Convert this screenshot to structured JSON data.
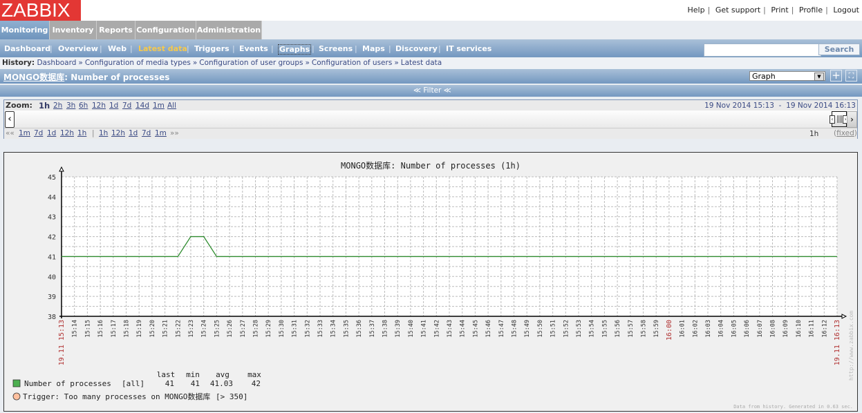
{
  "logo": "ZABBIX",
  "top_links": [
    "Help",
    "Get support",
    "Print",
    "Profile",
    "Logout"
  ],
  "main_menu": [
    {
      "label": "Monitoring",
      "active": true
    },
    {
      "label": "Inventory",
      "active": false
    },
    {
      "label": "Reports",
      "active": false
    },
    {
      "label": "Configuration",
      "active": false
    },
    {
      "label": "Administration",
      "active": false
    }
  ],
  "sub_menu": [
    {
      "label": "Dashboard"
    },
    {
      "label": "Overview"
    },
    {
      "label": "Web"
    },
    {
      "label": "Latest data",
      "active": true
    },
    {
      "label": "Triggers"
    },
    {
      "label": "Events"
    },
    {
      "label": "Graphs",
      "focused": true
    },
    {
      "label": "Screens"
    },
    {
      "label": "Maps"
    },
    {
      "label": "Discovery"
    },
    {
      "label": "IT services"
    }
  ],
  "search": {
    "value": "",
    "button": "Search"
  },
  "history": {
    "label": "History:",
    "items": [
      "Dashboard",
      "Configuration of media types",
      "Configuration of user groups",
      "Configuration of users",
      "Latest data"
    ],
    "separator": "»"
  },
  "title": {
    "host": "MONGO数据库",
    "item": ": Number of processes"
  },
  "view_select": {
    "selected": "Graph"
  },
  "icons": {
    "add": "plus-icon",
    "fullscreen": "fullscreen-icon"
  },
  "filter": {
    "label": "Filter",
    "icon": "double-chevron-up-icon"
  },
  "zoom": {
    "label": "Zoom:",
    "options": [
      "1h",
      "2h",
      "3h",
      "6h",
      "12h",
      "1d",
      "7d",
      "14d",
      "1m",
      "All"
    ],
    "selected": "1h",
    "period_from": "19 Nov 2014 15:13",
    "period_sep": "-",
    "period_to": "19 Nov 2014 16:13"
  },
  "nav": {
    "back_marker": "««",
    "back": [
      "1m",
      "7d",
      "1d",
      "12h",
      "1h"
    ],
    "sep": "|",
    "forward": [
      "1h",
      "12h",
      "1d",
      "7d",
      "1m"
    ],
    "forward_marker": "»»",
    "period": "1h",
    "fixed": "fixed"
  },
  "chart_data": {
    "type": "line",
    "title": "MONGO数据库: Number of processes (1h)",
    "ylim": [
      38,
      45
    ],
    "yticks": [
      38,
      39,
      40,
      41,
      42,
      43,
      44,
      45
    ],
    "grid": true,
    "x_start_label": "19.11 15:13",
    "x_end_label": "19.11 16:13",
    "x_highlight_label": "16:00",
    "x_minutes_start": "15:13",
    "x_minutes_count": 60,
    "series": [
      {
        "name": "Number of processes",
        "color": "#2e8b2e",
        "x_minutes": [
          0,
          9,
          10,
          11,
          12,
          60
        ],
        "values": [
          41,
          41,
          42,
          42,
          41,
          41
        ]
      }
    ],
    "legend": {
      "headers": [
        "last",
        "min",
        "avg",
        "max"
      ],
      "items": [
        {
          "name": "Number of processes",
          "func": "[all]",
          "last": "41",
          "min": "41",
          "avg": "41.03",
          "max": "42",
          "color": "#4caf50"
        }
      ],
      "trigger": {
        "label": "Trigger: Too many processes on MONGO数据库",
        "condition": "[> 350]",
        "color": "#ffc09f"
      }
    },
    "watermark": "http://www.zabbix.com",
    "footer": "Data from history. Generated in 0.63 sec."
  }
}
